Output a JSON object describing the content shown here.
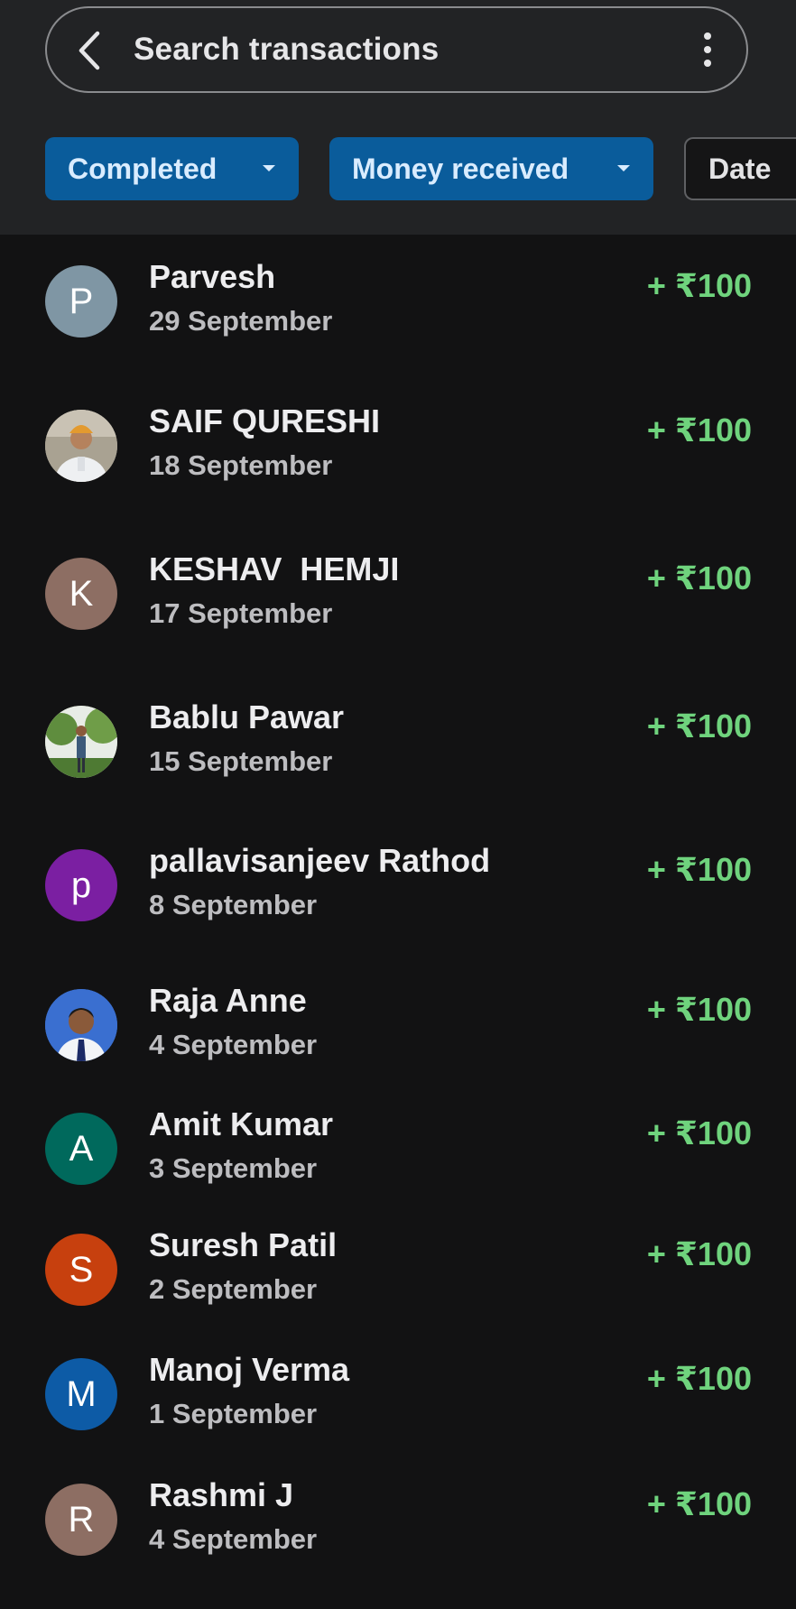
{
  "search": {
    "placeholder": "Search transactions"
  },
  "filters": [
    {
      "label": "Completed",
      "active": true
    },
    {
      "label": "Money received",
      "active": true
    },
    {
      "label": "Date",
      "active": false
    }
  ],
  "transactions": [
    {
      "name": "Parvesh",
      "date": "29 September",
      "amount": "+ ₹100",
      "avatar_letter": "P",
      "avatar_color": "#7f96a4"
    },
    {
      "name": "SAIF QURESHI",
      "date": "18 September",
      "amount": "+ ₹100",
      "avatar_photo": "person-photo-turban"
    },
    {
      "name": "KESHAV  HEMJI",
      "date": "17 September",
      "amount": "+ ₹100",
      "avatar_letter": "K",
      "avatar_color": "#8d6e63"
    },
    {
      "name": "Bablu Pawar",
      "date": "15 September",
      "amount": "+ ₹100",
      "avatar_photo": "person-photo-outdoor"
    },
    {
      "name": "pallavisanjeev Rathod",
      "date": "8 September",
      "amount": "+ ₹100",
      "avatar_letter": "p",
      "avatar_color": "#7b1fa2"
    },
    {
      "name": "Raja Anne",
      "date": "4 September",
      "amount": "+ ₹100",
      "avatar_photo": "person-photo-portrait"
    },
    {
      "name": "Amit Kumar",
      "date": "3 September",
      "amount": "+ ₹100",
      "avatar_letter": "A",
      "avatar_color": "#00695c"
    },
    {
      "name": "Suresh Patil",
      "date": "2 September",
      "amount": "+ ₹100",
      "avatar_letter": "S",
      "avatar_color": "#c7400e"
    },
    {
      "name": "Manoj Verma",
      "date": "1 September",
      "amount": "+ ₹100",
      "avatar_letter": "M",
      "avatar_color": "#0d5ba6"
    },
    {
      "name": "Rashmi J",
      "date": "4 September",
      "amount": "+ ₹100",
      "avatar_letter": "R",
      "avatar_color": "#8d6e63"
    }
  ],
  "colors": {
    "background": "#121213",
    "header": "#222325",
    "chip_active": "#0a5c9b",
    "amount_positive": "#6fd37d"
  }
}
